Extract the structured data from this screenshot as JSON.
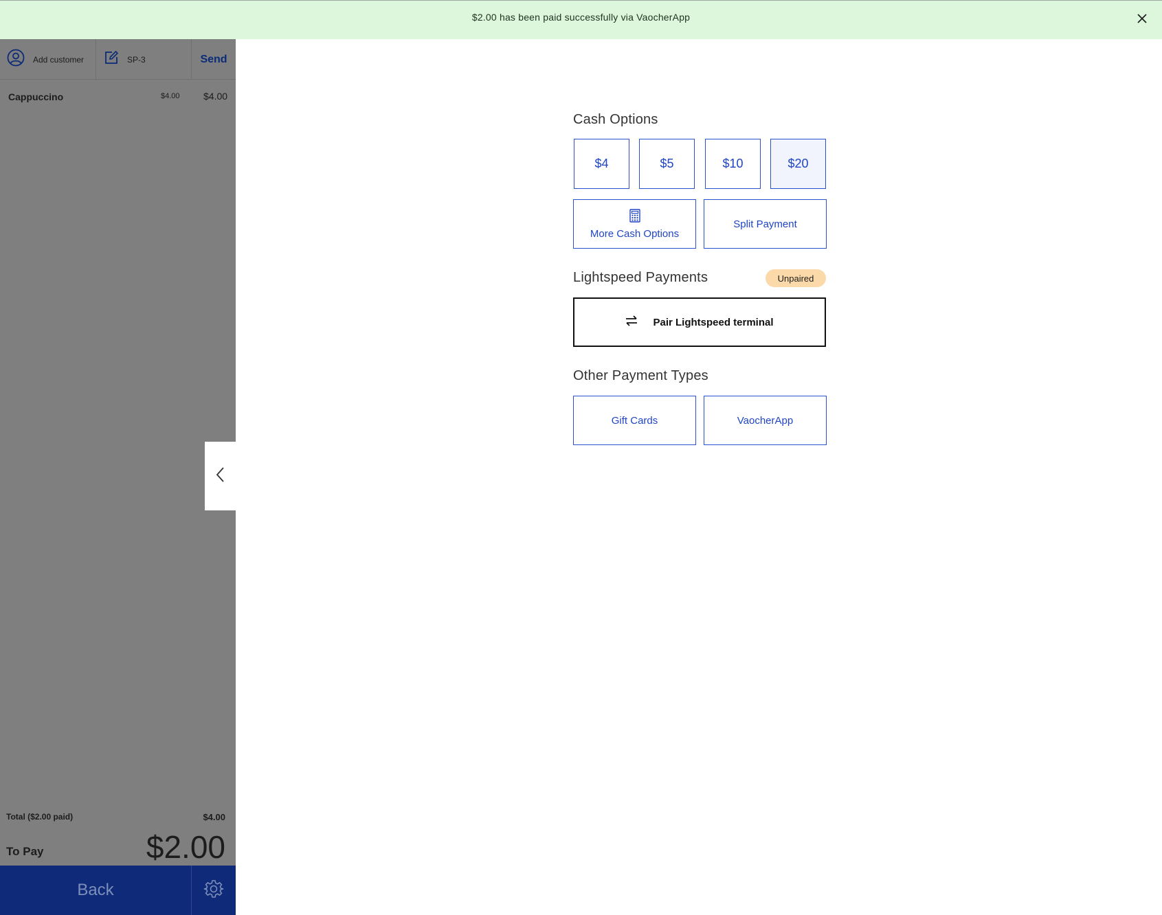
{
  "banner": {
    "message": "$2.00 has been paid successfully via VaocherApp"
  },
  "sidebar": {
    "customer_label": "Add customer",
    "ticket_label": "SP-3",
    "send_label": "Send",
    "order_items": [
      {
        "name": "Cappuccino",
        "unit_price": "$4.00",
        "line_total": "$4.00"
      }
    ],
    "total_label": "Total ($2.00 paid)",
    "total_value": "$4.00",
    "to_pay_label": "To Pay",
    "to_pay_value": "$2.00",
    "back_label": "Back"
  },
  "cash_options": {
    "title": "Cash Options",
    "amounts": [
      "$4",
      "$5",
      "$10",
      "$20"
    ],
    "selected": "$20",
    "more_label": "More Cash Options",
    "split_label": "Split Payment"
  },
  "lightspeed": {
    "title": "Lightspeed Payments",
    "status": "Unpaired",
    "pair_label": "Pair Lightspeed terminal"
  },
  "other_types": {
    "title": "Other Payment Types",
    "options": [
      "Gift Cards",
      "VaocherApp"
    ]
  },
  "colors": {
    "banner_bg": "#dcf7dc",
    "accent": "#1f45c6",
    "nav_blue": "#0e2a79",
    "badge_bg": "#fcd9a8",
    "overlay_gray": "#7f7f7f"
  },
  "icons": [
    "close-icon",
    "user-icon",
    "edit-icon",
    "chevron-left-icon",
    "gear-icon",
    "calculator-icon",
    "swap-arrows-icon"
  ]
}
